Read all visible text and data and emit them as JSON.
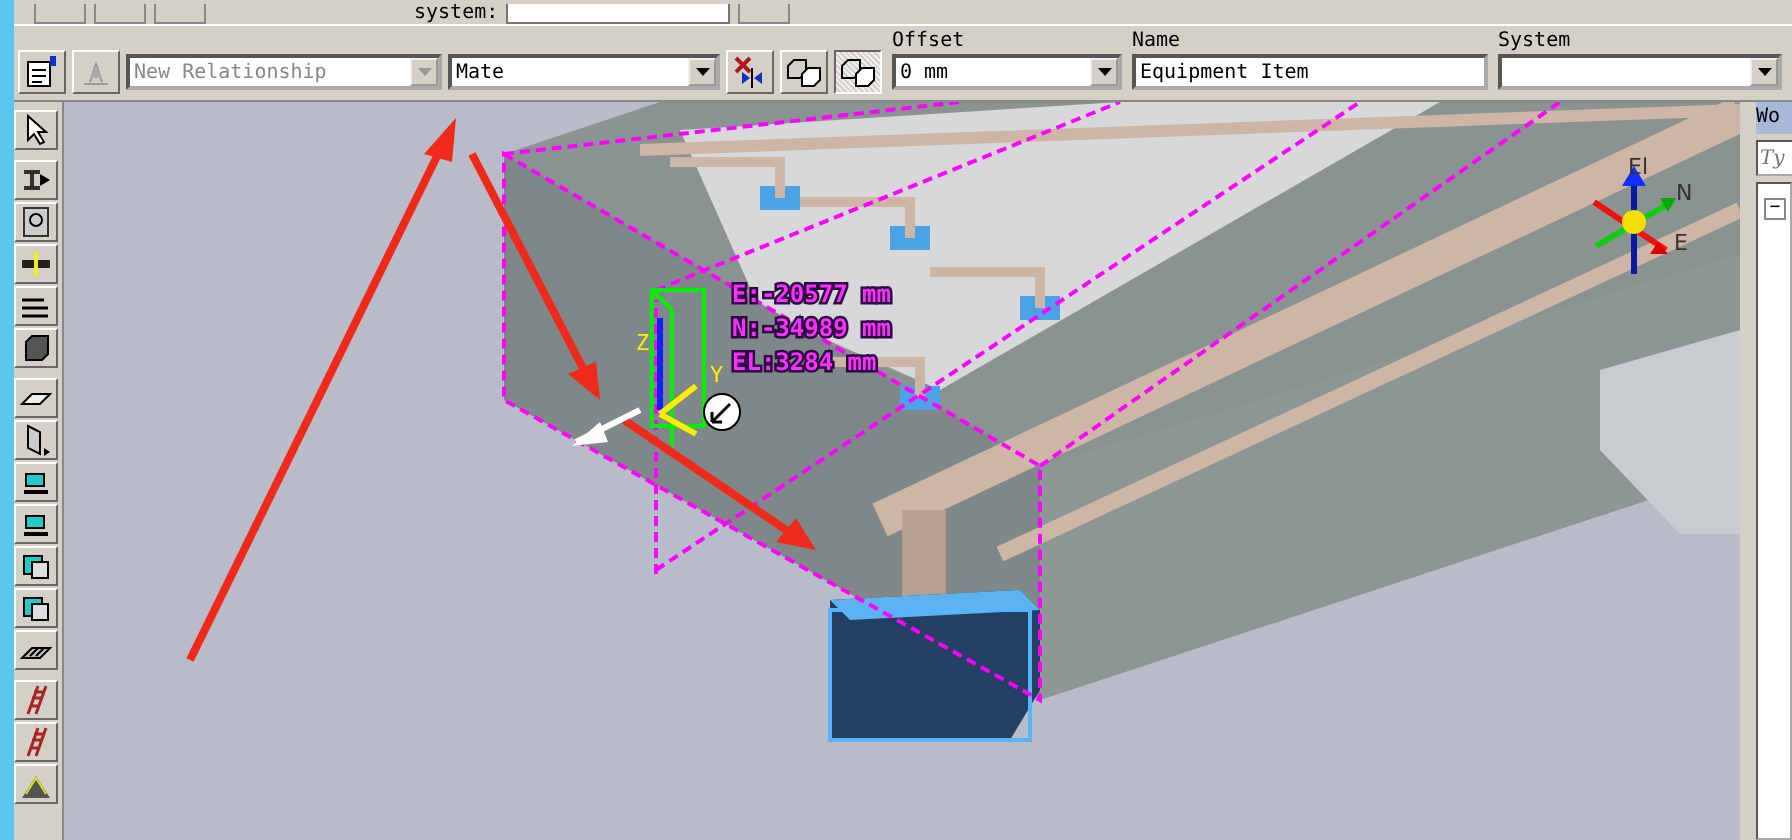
{
  "top_bar": {
    "system_label": "system:"
  },
  "toolbar": {
    "relationship": {
      "value": "New Relationship",
      "disabled": true
    },
    "mate": {
      "value": "Mate"
    },
    "toggle_buttons": [
      {
        "selected": false
      },
      {
        "selected": true
      }
    ],
    "offset": {
      "label": "Offset",
      "value": "0 mm"
    },
    "name": {
      "label": "Name",
      "value": "Equipment Item"
    },
    "system": {
      "label": "System"
    }
  },
  "viewport": {
    "readouts": [
      "E:-20577 mm",
      "N:-34989 mm",
      "EL:3284 mm"
    ],
    "axis_labels": {
      "z": "Z",
      "y": "Y"
    },
    "compass": {
      "up": "El",
      "north": "N",
      "east": "E"
    }
  },
  "side_panel": {
    "title": "Wo",
    "filter_placeholder": "Ty",
    "tree_expander": "−"
  }
}
